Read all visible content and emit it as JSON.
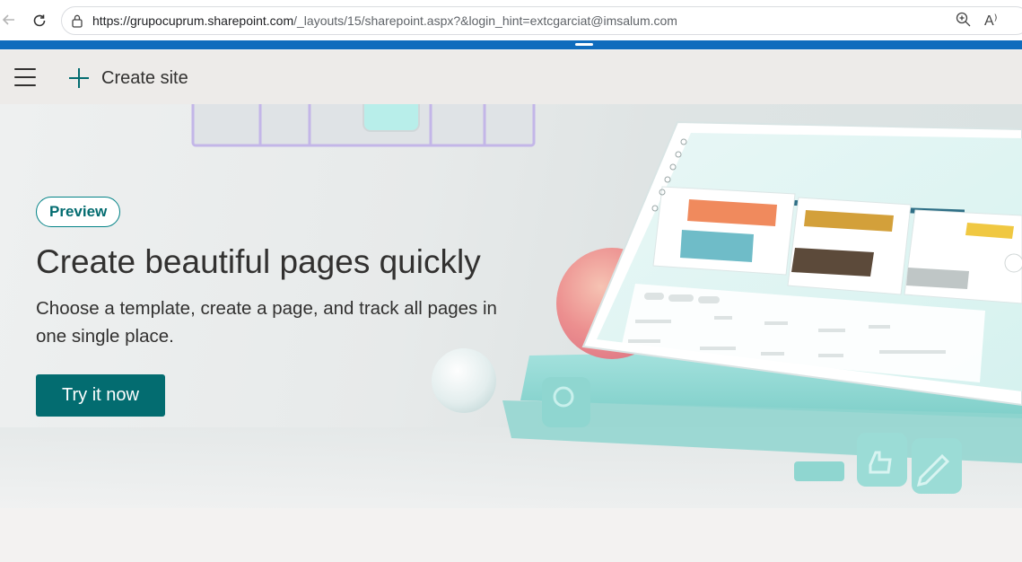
{
  "browser": {
    "url_host": "https://grupocuprum.sharepoint.com",
    "url_path": "/_layouts/15/sharepoint.aspx?&login_hint=extcgarciat@imsalum.com",
    "icons": {
      "back": "back-arrow-icon",
      "refresh": "refresh-icon",
      "lock": "lock-icon",
      "zoom": "zoom-in-icon",
      "read_aloud": "read-aloud-icon"
    },
    "read_aloud_glyph": "A⁾"
  },
  "command_bar": {
    "create_site_label": "Create site"
  },
  "hero": {
    "badge": "Preview",
    "title": "Create beautiful pages quickly",
    "subtitle": "Choose a template, create a page, and track all pages in one single place.",
    "cta_label": "Try it now"
  },
  "colors": {
    "accent": "#036c70",
    "browser_strip": "#0f6cbd",
    "command_bar_bg": "#edebe9"
  }
}
